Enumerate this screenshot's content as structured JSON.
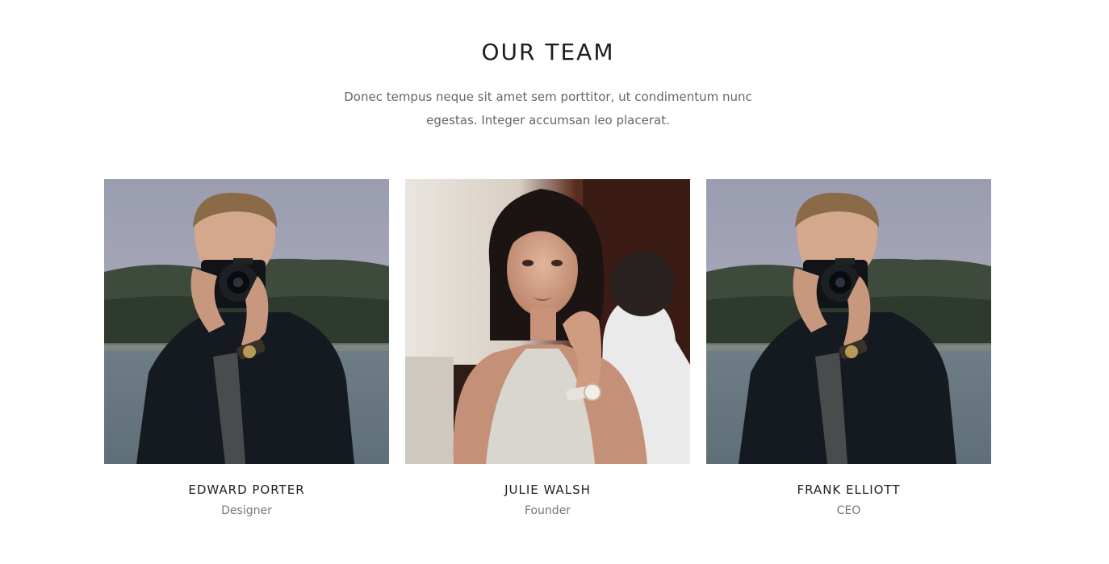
{
  "section": {
    "title": "OUR TEAM",
    "description": "Donec tempus neque sit amet sem porttitor, ut condimentum nunc egestas. Integer accumsan leo placerat."
  },
  "team": [
    {
      "name": "EDWARD PORTER",
      "role": "Designer",
      "photo": "man-with-camera-photo"
    },
    {
      "name": "JULIE WALSH",
      "role": "Founder",
      "photo": "woman-portrait-photo"
    },
    {
      "name": "FRANK ELLIOTT",
      "role": "CEO",
      "photo": "man-with-camera-photo"
    }
  ],
  "colors": {
    "title": "#1e1e1e",
    "text": "#666666",
    "background": "#ffffff"
  }
}
